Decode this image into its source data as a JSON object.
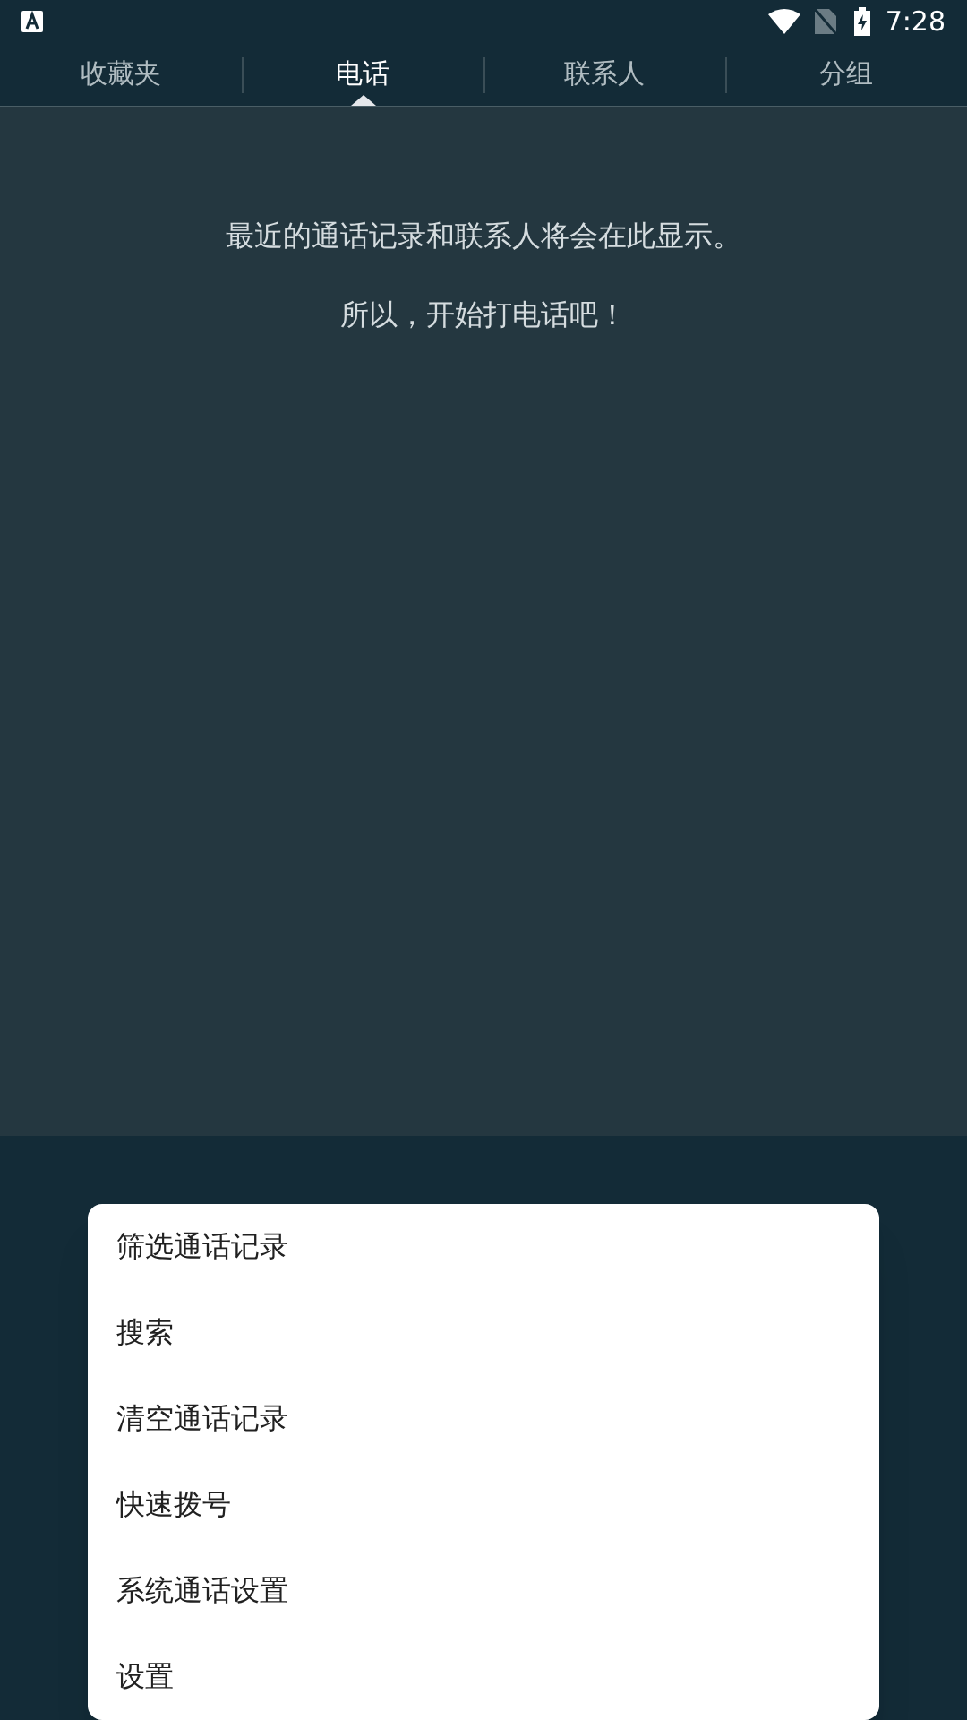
{
  "status_bar": {
    "time": "7:28"
  },
  "tabs": [
    {
      "label": "收藏夹",
      "selected": false
    },
    {
      "label": "电话",
      "selected": true
    },
    {
      "label": "联系人",
      "selected": false
    },
    {
      "label": "分组",
      "selected": false
    }
  ],
  "empty_state": {
    "lines": [
      "最近的通话记录和联系人将会在此显示。",
      "所以，开始打电话吧！"
    ]
  },
  "menu": {
    "items": [
      "筛选通话记录",
      "搜索",
      "清空通话记录",
      "快速拨号",
      "系统通话设置",
      "设置"
    ]
  }
}
